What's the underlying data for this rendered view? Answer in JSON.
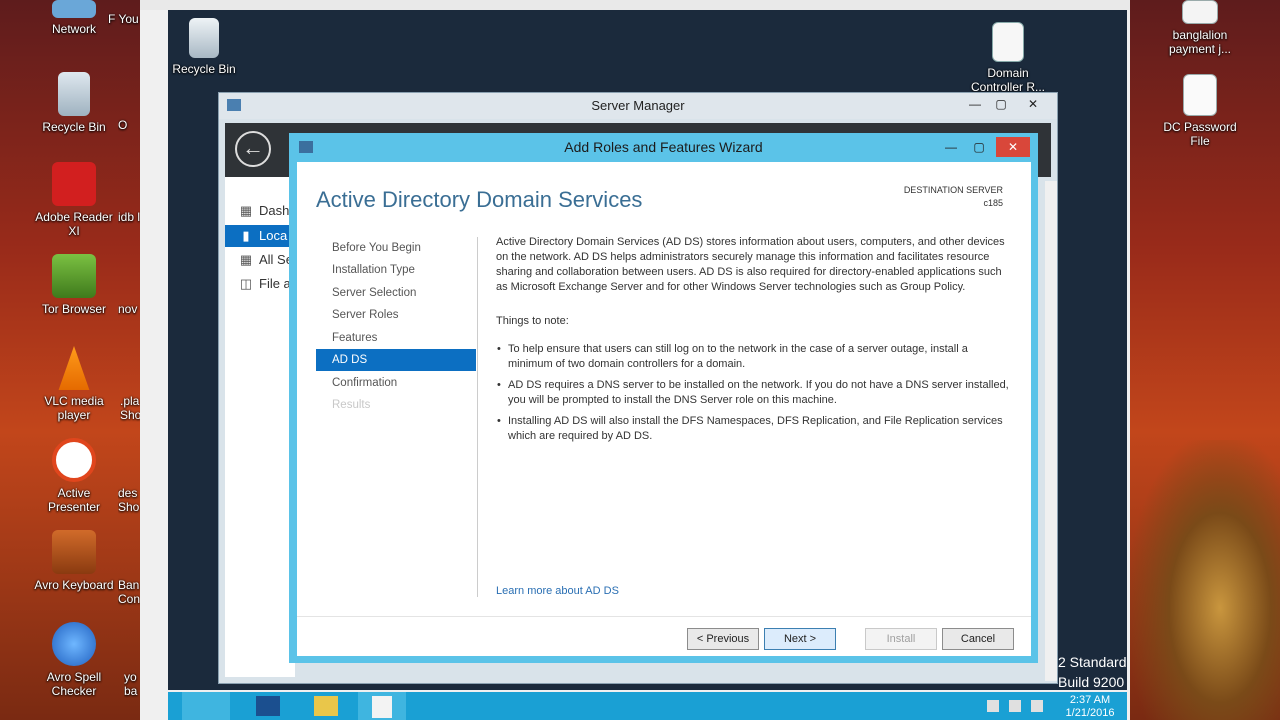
{
  "host": {
    "left_icons": [
      {
        "label": "Network",
        "icon": "network-icon"
      },
      {
        "label": "Recycle Bin",
        "icon": "recycle-bin-icon"
      },
      {
        "label": "Adobe Reader XI",
        "icon": "adobe-reader-icon"
      },
      {
        "label": "Tor Browser",
        "icon": "tor-browser-icon"
      },
      {
        "label": "VLC media player",
        "icon": "vlc-icon"
      },
      {
        "label": "Active Presenter",
        "icon": "active-presenter-icon"
      },
      {
        "label": "Avro Keyboard",
        "icon": "avro-keyboard-icon"
      },
      {
        "label": "Avro Spell Checker",
        "icon": "avro-spell-checker-icon"
      }
    ],
    "partial_icons": [
      "F You",
      "O",
      "idb l",
      "nov",
      ".pla Sho",
      "des Sho",
      "Ban Con",
      "yo ba"
    ],
    "right_icons": [
      {
        "label": "banglalion payment j...",
        "icon": "document-icon"
      },
      {
        "label": "DC Password File",
        "icon": "text-file-icon"
      }
    ]
  },
  "guest": {
    "desktop_icons": [
      {
        "label": "Recycle Bin",
        "icon": "recycle-bin-icon"
      },
      {
        "label": "Domain Controller R...",
        "icon": "document-icon"
      }
    ],
    "version_lines": [
      "2 Standard",
      "Build 9200"
    ],
    "clock": {
      "time": "2:37 AM",
      "date": "1/21/2016"
    }
  },
  "server_manager": {
    "title": "Server Manager",
    "side_items": [
      {
        "label": "Dash",
        "icon": "dashboard-icon"
      },
      {
        "label": "Loca",
        "icon": "local-server-icon"
      },
      {
        "label": "All Se",
        "icon": "all-servers-icon"
      },
      {
        "label": "File a",
        "icon": "file-services-icon"
      }
    ]
  },
  "wizard": {
    "title": "Add Roles and Features Wizard",
    "heading": "Active Directory Domain Services",
    "destination_label": "DESTINATION SERVER",
    "destination_server": "c185",
    "steps": [
      {
        "label": "Before You Begin",
        "state": "normal"
      },
      {
        "label": "Installation Type",
        "state": "normal"
      },
      {
        "label": "Server Selection",
        "state": "normal"
      },
      {
        "label": "Server Roles",
        "state": "normal"
      },
      {
        "label": "Features",
        "state": "normal"
      },
      {
        "label": "AD DS",
        "state": "active"
      },
      {
        "label": "Confirmation",
        "state": "normal"
      },
      {
        "label": "Results",
        "state": "disabled"
      }
    ],
    "intro": "Active Directory Domain Services (AD DS) stores information about users, computers, and other devices on the network.  AD DS helps administrators securely manage this information and facilitates resource sharing and collaboration between users.  AD DS is also required for directory-enabled applications such as Microsoft Exchange Server and for other Windows Server technologies such as Group Policy.",
    "notes_title": "Things to note:",
    "notes": [
      "To help ensure that users can still log on to the network in the case of a server outage, install a minimum of two domain controllers for a domain.",
      "AD DS requires a DNS server to be installed on the network.  If you do not have a DNS server installed, you will be prompted to install the DNS Server role on this machine.",
      "Installing AD DS will also install the DFS Namespaces, DFS Replication, and File Replication services which are required by AD DS."
    ],
    "learn_more": "Learn more about AD DS",
    "buttons": {
      "previous": "< Previous",
      "next": "Next >",
      "install": "Install",
      "cancel": "Cancel"
    }
  },
  "colors": {
    "wizard_frame": "#5bc3e8",
    "selection": "#0c6fc2",
    "heading": "#3a6e94",
    "link": "#2a6fb3",
    "taskbar": "#1aa0d4"
  }
}
